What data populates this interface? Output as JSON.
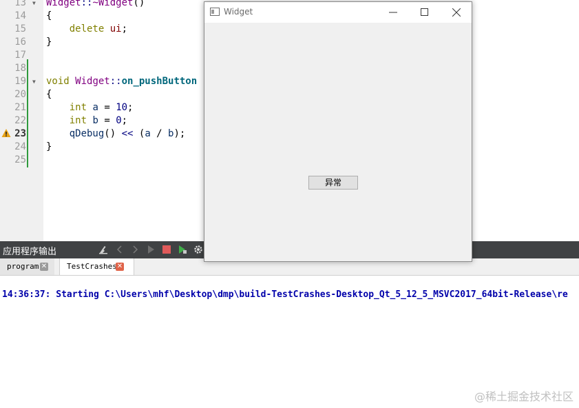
{
  "editor": {
    "lines": [
      {
        "num": "13",
        "segments": [
          {
            "t": "Widget",
            "c": "cls"
          },
          {
            "t": "::",
            "c": "op"
          },
          {
            "t": "~Widget",
            "c": "cls"
          },
          {
            "t": "()",
            "c": ""
          }
        ]
      },
      {
        "num": "14",
        "segments": [
          {
            "t": "{",
            "c": ""
          }
        ]
      },
      {
        "num": "15",
        "segments": [
          {
            "t": "    delete",
            "c": "kw"
          },
          {
            "t": " ",
            "c": ""
          },
          {
            "t": "ui",
            "c": "mem"
          },
          {
            "t": ";",
            "c": ""
          }
        ]
      },
      {
        "num": "16",
        "segments": [
          {
            "t": "}",
            "c": ""
          }
        ]
      },
      {
        "num": "17",
        "segments": []
      },
      {
        "num": "18",
        "segments": []
      },
      {
        "num": "19",
        "segments": [
          {
            "t": "void",
            "c": "kw"
          },
          {
            "t": " ",
            "c": ""
          },
          {
            "t": "Widget",
            "c": "cls"
          },
          {
            "t": "::",
            "c": "op"
          },
          {
            "t": "on_pushButton",
            "c": "fn"
          }
        ]
      },
      {
        "num": "20",
        "segments": [
          {
            "t": "{",
            "c": ""
          }
        ]
      },
      {
        "num": "21",
        "segments": [
          {
            "t": "    int",
            "c": "kw"
          },
          {
            "t": " ",
            "c": ""
          },
          {
            "t": "a",
            "c": "var"
          },
          {
            "t": " = ",
            "c": ""
          },
          {
            "t": "10",
            "c": "num"
          },
          {
            "t": ";",
            "c": ""
          }
        ]
      },
      {
        "num": "22",
        "segments": [
          {
            "t": "    int",
            "c": "kw"
          },
          {
            "t": " ",
            "c": ""
          },
          {
            "t": "b",
            "c": "var"
          },
          {
            "t": " = ",
            "c": ""
          },
          {
            "t": "0",
            "c": "num"
          },
          {
            "t": ";",
            "c": ""
          }
        ]
      },
      {
        "num": "23",
        "segments": [
          {
            "t": "    qDebug",
            "c": "var"
          },
          {
            "t": "() ",
            "c": ""
          },
          {
            "t": "<<",
            "c": "op"
          },
          {
            "t": " (",
            "c": ""
          },
          {
            "t": "a",
            "c": "var"
          },
          {
            "t": " / ",
            "c": ""
          },
          {
            "t": "b",
            "c": "var"
          },
          {
            "t": ");",
            "c": ""
          }
        ]
      },
      {
        "num": "24",
        "segments": [
          {
            "t": "}",
            "c": ""
          }
        ]
      },
      {
        "num": "25",
        "segments": []
      }
    ],
    "warning_line": "23",
    "fold_lines": [
      "13",
      "19"
    ]
  },
  "output_panel": {
    "title": "应用程序输出",
    "tabs": [
      {
        "label": "program",
        "active": false
      },
      {
        "label": "TestCrashes",
        "active": true
      }
    ],
    "close_glyph": "✕",
    "log_line": "14:36:37: Starting C:\\Users\\mhf\\Desktop\\dmp\\build-TestCrashes-Desktop_Qt_5_12_5_MSVC2017_64bit-Release\\re"
  },
  "widget_window": {
    "title": "Widget",
    "button_label": "异常"
  },
  "watermark": "@稀土掘金技术社区",
  "colors": {
    "toolbar_bg": "#404244",
    "change_bar": "#2e9a3c",
    "log_text": "#0000aa",
    "active_tab_close": "#e0644a"
  }
}
